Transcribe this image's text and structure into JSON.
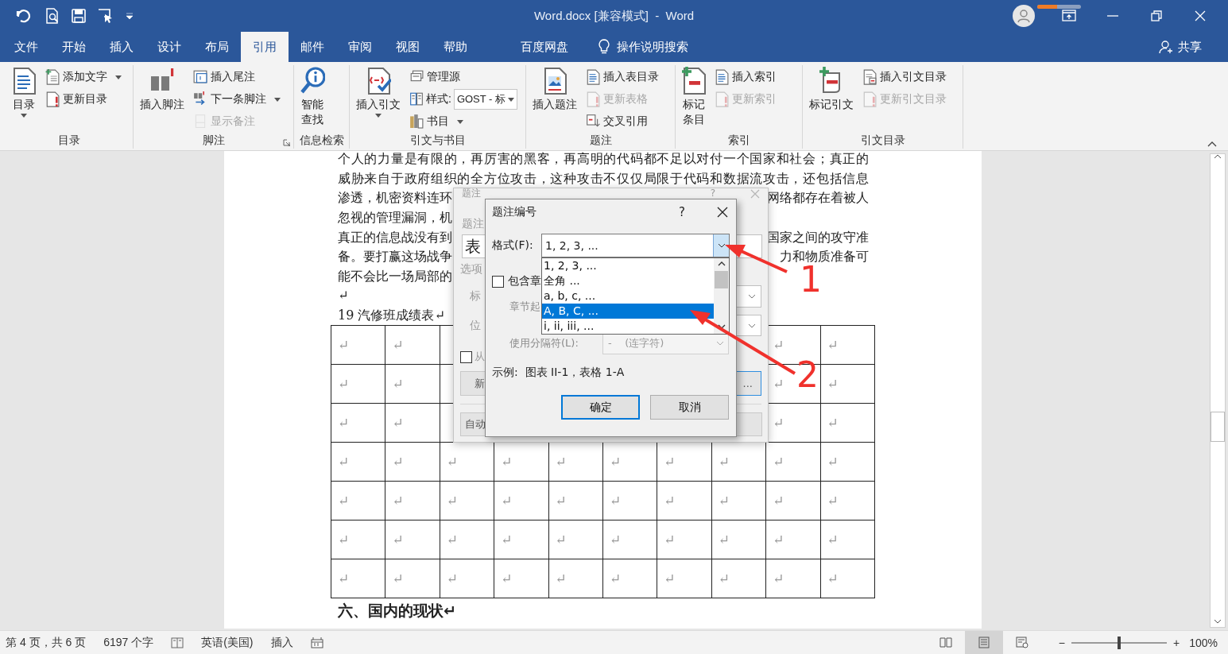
{
  "title_bar": {
    "title": "Word.docx [兼容模式]  -  Word",
    "sync_progress": {
      "level": 0.45
    }
  },
  "tabs": [
    {
      "label": "文件",
      "selected": false
    },
    {
      "label": "开始",
      "selected": false
    },
    {
      "label": "插入",
      "selected": false
    },
    {
      "label": "设计",
      "selected": false
    },
    {
      "label": "布局",
      "selected": false
    },
    {
      "label": "引用",
      "selected": true
    },
    {
      "label": "邮件",
      "selected": false
    },
    {
      "label": "审阅",
      "selected": false
    },
    {
      "label": "视图",
      "selected": false
    },
    {
      "label": "帮助",
      "selected": false
    },
    {
      "label": "百度网盘",
      "selected": false
    }
  ],
  "tell_me": {
    "label": "操作说明搜索"
  },
  "share": {
    "label": "共享"
  },
  "ribbon": {
    "groups": [
      {
        "label": "目录",
        "launcher": false,
        "large": [
          {
            "label": "目录",
            "dropdown": true
          }
        ],
        "small": [
          {
            "kind": "button",
            "label": "添加文字",
            "dropdown": true,
            "disabled": false
          },
          {
            "kind": "button",
            "label": "更新目录",
            "dropdown": false,
            "disabled": false
          }
        ]
      },
      {
        "label": "脚注",
        "launcher": true,
        "large": [
          {
            "label": "插入脚注",
            "dropdown": false
          }
        ],
        "small": [
          {
            "kind": "button",
            "label": "插入尾注",
            "dropdown": false,
            "disabled": false
          },
          {
            "kind": "button",
            "label": "下一条脚注",
            "dropdown": true,
            "disabled": false
          },
          {
            "kind": "button",
            "label": "显示备注",
            "dropdown": false,
            "disabled": true
          }
        ]
      },
      {
        "label": "信息检索",
        "launcher": false,
        "large": [
          {
            "label": "智能查找",
            "dropdown": false
          }
        ]
      },
      {
        "label": "引文与书目",
        "launcher": false,
        "large": [
          {
            "label": "插入引文",
            "dropdown": true
          }
        ],
        "small": [
          {
            "kind": "button",
            "label": "管理源",
            "dropdown": false,
            "disabled": false
          },
          {
            "kind": "combo",
            "label": "样式:",
            "value": "GOST - 标",
            "dropdown": true,
            "disabled": false
          },
          {
            "kind": "button",
            "label": "书目",
            "dropdown": true,
            "disabled": false
          }
        ]
      },
      {
        "label": "题注",
        "launcher": false,
        "large": [
          {
            "label": "插入题注",
            "dropdown": false
          }
        ],
        "small": [
          {
            "kind": "button",
            "label": "插入表目录",
            "dropdown": false,
            "disabled": false
          },
          {
            "kind": "button",
            "label": "更新表格",
            "dropdown": false,
            "disabled": true
          },
          {
            "kind": "button",
            "label": "交叉引用",
            "dropdown": false,
            "disabled": false
          }
        ]
      },
      {
        "label": "索引",
        "launcher": false,
        "large": [
          {
            "label": "标记条目",
            "dropdown": false
          }
        ],
        "small": [
          {
            "kind": "button",
            "label": "插入索引",
            "dropdown": false,
            "disabled": false
          },
          {
            "kind": "button",
            "label": "更新索引",
            "dropdown": false,
            "disabled": true
          }
        ]
      },
      {
        "label": "引文目录",
        "launcher": false,
        "large": [
          {
            "label": "标记引文",
            "dropdown": false
          }
        ],
        "small": [
          {
            "kind": "button",
            "label": "插入引文目录",
            "dropdown": false,
            "disabled": false
          },
          {
            "kind": "button",
            "label": "更新引文目录",
            "dropdown": false,
            "disabled": true
          }
        ]
      }
    ]
  },
  "document": {
    "lines": [
      {
        "kind": "full",
        "left": "个人的力量是有限的，再厉害的黑客，再高明的代码都不足以对付一个国家和社会；真正的"
      },
      {
        "kind": "full",
        "left": "威胁来自于政府组织的全方位攻击，这种攻击不仅仅局限于代码和数据流攻击，还包括信息"
      },
      {
        "kind": "fragment",
        "left": "渗透，机密资料连环",
        "right": "网络都存在着被人"
      },
      {
        "kind": "fragment",
        "left": "忽视的管理漏洞，机"
      },
      {
        "kind": "fragment",
        "left": "真正的信息战没有到",
        "right": "国家之间的攻守准"
      },
      {
        "kind": "fragment",
        "left": "备。要打赢这场战争",
        "right": "力和物质准备可"
      },
      {
        "kind": "fragment",
        "left": "能不会比一场局部的"
      },
      {
        "kind": "fragment",
        "left": "↵"
      },
      {
        "kind": "fragment",
        "left": "19 汽修班成绩表↵"
      }
    ],
    "table": {
      "rows": [
        [
          "↵",
          "↵",
          null,
          null,
          null,
          null,
          null,
          null,
          "↵",
          "↵"
        ],
        [
          "↵",
          "↵",
          null,
          null,
          null,
          null,
          null,
          null,
          "↵",
          "↵"
        ],
        [
          "↵",
          "↵",
          null,
          null,
          null,
          null,
          null,
          null,
          "↵",
          "↵"
        ],
        [
          "↵",
          "↵",
          "↵",
          "↵",
          "↵",
          "↵",
          "↵",
          "↵",
          "↵",
          "↵"
        ],
        [
          "↵",
          "↵",
          "↵",
          "↵",
          "↵",
          "↵",
          "↵",
          "↵",
          "↵",
          "↵"
        ],
        [
          "↵",
          "↵",
          "↵",
          "↵",
          "↵",
          "↵",
          "↵",
          "↵",
          "↵",
          "↵"
        ],
        [
          "↵",
          "↵",
          "↵",
          "↵",
          "↵",
          "↵",
          "↵",
          "↵",
          "↵",
          "↵"
        ]
      ]
    },
    "heading": "六、国内的现状↵"
  },
  "caption_dialog": {
    "title": "题注",
    "help": "?",
    "caption_label": "题注",
    "caption_value": "表",
    "options_label": "选项",
    "label_label": "标",
    "position_label": "位",
    "exclude": {
      "label": "从",
      "checked": false
    },
    "buttons": [
      {
        "label": "新",
        "default": false
      },
      {
        "label": "...",
        "default": true
      }
    ],
    "auto_button": "自动"
  },
  "numbering_dialog": {
    "title": "题注编号",
    "help": "?",
    "format_label": "格式(F):",
    "format_value": "1, 2, 3, ...",
    "format_options": [
      {
        "label": "1, 2, 3, ...",
        "selected": false
      },
      {
        "label": "全角 ...",
        "selected": false
      },
      {
        "label": "a, b, c, ...",
        "selected": false
      },
      {
        "label": "A, B, C, ...",
        "selected": true
      },
      {
        "label": "i, ii, iii, ...",
        "selected": false
      }
    ],
    "include_chapter": {
      "label": "包含章",
      "checked": false
    },
    "chapter_start_label": "章节起",
    "separator_label": "使用分隔符(L):",
    "separator_value": "-    (连字符)",
    "example": "示例:  图表 II-1，表格 1-A",
    "buttons": [
      {
        "label": "确定",
        "default": true
      },
      {
        "label": "取消",
        "default": false
      }
    ]
  },
  "annotations": [
    {
      "label": "1"
    },
    {
      "label": "2"
    }
  ],
  "status_bar": {
    "page": "第 4 页，共 6 页",
    "words": "6197 个字",
    "language": "英语(美国)",
    "mode": "插入",
    "views": [
      {
        "selected": false
      },
      {
        "selected": true
      },
      {
        "selected": false
      }
    ],
    "zoom_out": "−",
    "zoom_in": "+",
    "zoom": {
      "level": 0.5
    },
    "zoom_percent": "100%"
  }
}
